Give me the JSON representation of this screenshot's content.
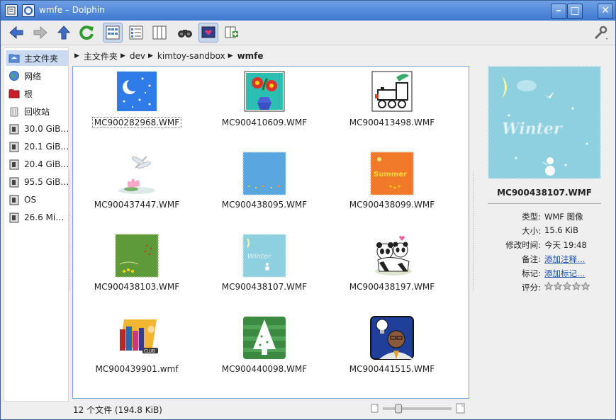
{
  "window": {
    "title": "wmfe – Dolphin"
  },
  "window_controls": {
    "close": "✕",
    "maximize": "□",
    "minimize": "–"
  },
  "toolbar": {
    "items": [
      "back-icon",
      "forward-icon",
      "up-icon",
      "reload-icon",
      "icons-view-icon",
      "details-view-icon",
      "columns-view-icon",
      "find-icon",
      "preview-icon",
      "split-icon",
      "settings-icon"
    ]
  },
  "places": [
    {
      "label": "主文件夹",
      "icon": "home-folder-icon"
    },
    {
      "label": "网络",
      "icon": "network-icon"
    },
    {
      "label": "根",
      "icon": "root-folder-icon"
    },
    {
      "label": "回收站",
      "icon": "trash-icon"
    },
    {
      "label": "30.0 GiB…",
      "icon": "drive-icon"
    },
    {
      "label": "20.1 GiB…",
      "icon": "drive-icon"
    },
    {
      "label": "20.4 GiB…",
      "icon": "drive-icon"
    },
    {
      "label": "95.5 GiB…",
      "icon": "drive-icon"
    },
    {
      "label": "OS",
      "icon": "drive-icon"
    },
    {
      "label": "26.6 Mi…",
      "icon": "drive-icon"
    }
  ],
  "breadcrumb": [
    "主文件夹",
    "dev",
    "kimtoy-sandbox",
    "wmfe"
  ],
  "files": [
    {
      "name": "MC900282968.WMF",
      "thumb": "night-moon-thumb"
    },
    {
      "name": "MC900410609.WMF",
      "thumb": "flower-vase-thumb"
    },
    {
      "name": "MC900413498.WMF",
      "thumb": "train-thumb"
    },
    {
      "name": "MC900437447.WMF",
      "thumb": "dragonfly-lotus-thumb"
    },
    {
      "name": "MC900438095.WMF",
      "thumb": "blue-stamp-thumb"
    },
    {
      "name": "MC900438099.WMF",
      "thumb": "summer-stamp-thumb"
    },
    {
      "name": "MC900438103.WMF",
      "thumb": "green-stamp-thumb"
    },
    {
      "name": "MC900438107.WMF",
      "thumb": "winter-stamp-thumb"
    },
    {
      "name": "MC900438197.WMF",
      "thumb": "pandas-thumb"
    },
    {
      "name": "MC900439901.wmf",
      "thumb": "book-club-thumb"
    },
    {
      "name": "MC900440098.WMF",
      "thumb": "christmas-tree-thumb"
    },
    {
      "name": "MC900441515.WMF",
      "thumb": "idea-man-thumb"
    }
  ],
  "info": {
    "name": "MC900438107.WMF",
    "preview_text": "Winter",
    "rows": [
      {
        "key": "类型:",
        "value": "WMF 图像"
      },
      {
        "key": "大小:",
        "value": "15.6 KiB"
      },
      {
        "key": "修改时间:",
        "value": "今天 19:48"
      },
      {
        "key": "备注:",
        "value": "添加注释…"
      },
      {
        "key": "标记:",
        "value": "添加标记…"
      },
      {
        "key": "评分:",
        "value": ""
      }
    ],
    "rating": 0,
    "rating_max": 5
  },
  "status": {
    "text": "12 个文件 (194.8 KiB)"
  },
  "zoom": {
    "level": 0.2
  },
  "colors": {
    "title_bar": "#4a82d4",
    "selection": "#c9daf2",
    "link": "#1a4fb0",
    "view_border": "#7aa3d8"
  }
}
